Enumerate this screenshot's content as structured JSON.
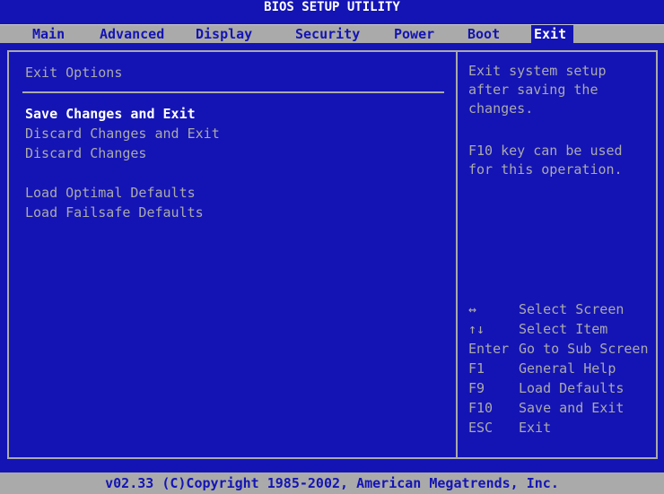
{
  "title": "BIOS SETUP UTILITY",
  "menu": {
    "tabs": [
      {
        "label": "Main"
      },
      {
        "label": "Advanced"
      },
      {
        "label": "Display"
      },
      {
        "label": "Security"
      },
      {
        "label": "Power"
      },
      {
        "label": "Boot"
      },
      {
        "label": "Exit",
        "active": true
      }
    ]
  },
  "main": {
    "section_title": "Exit Options",
    "options": [
      {
        "label": "Save Changes and Exit",
        "selected": true
      },
      {
        "label": "Discard Changes and Exit"
      },
      {
        "label": "Discard Changes"
      },
      {
        "label": "Load Optimal Defaults"
      },
      {
        "label": "Load Failsafe Defaults"
      }
    ]
  },
  "help": {
    "lines": [
      "Exit system setup",
      "after saving the",
      "changes.",
      "",
      "F10 key can be used",
      "for this operation."
    ]
  },
  "keys": [
    {
      "key": "↔",
      "desc": "Select Screen"
    },
    {
      "key": "↑↓",
      "desc": "Select Item"
    },
    {
      "key": "Enter",
      "desc": "Go to Sub Screen"
    },
    {
      "key": "F1",
      "desc": "General Help"
    },
    {
      "key": "F9",
      "desc": "Load Defaults"
    },
    {
      "key": "F10",
      "desc": "Save and Exit"
    },
    {
      "key": "ESC",
      "desc": "Exit"
    }
  ],
  "footer": "v02.33 (C)Copyright 1985-2002, American Megatrends, Inc.",
  "colors": {
    "background": "#1414b4",
    "bar": "#aaaaaa",
    "text": "#aaaaaa",
    "highlight": "#ffffff"
  }
}
